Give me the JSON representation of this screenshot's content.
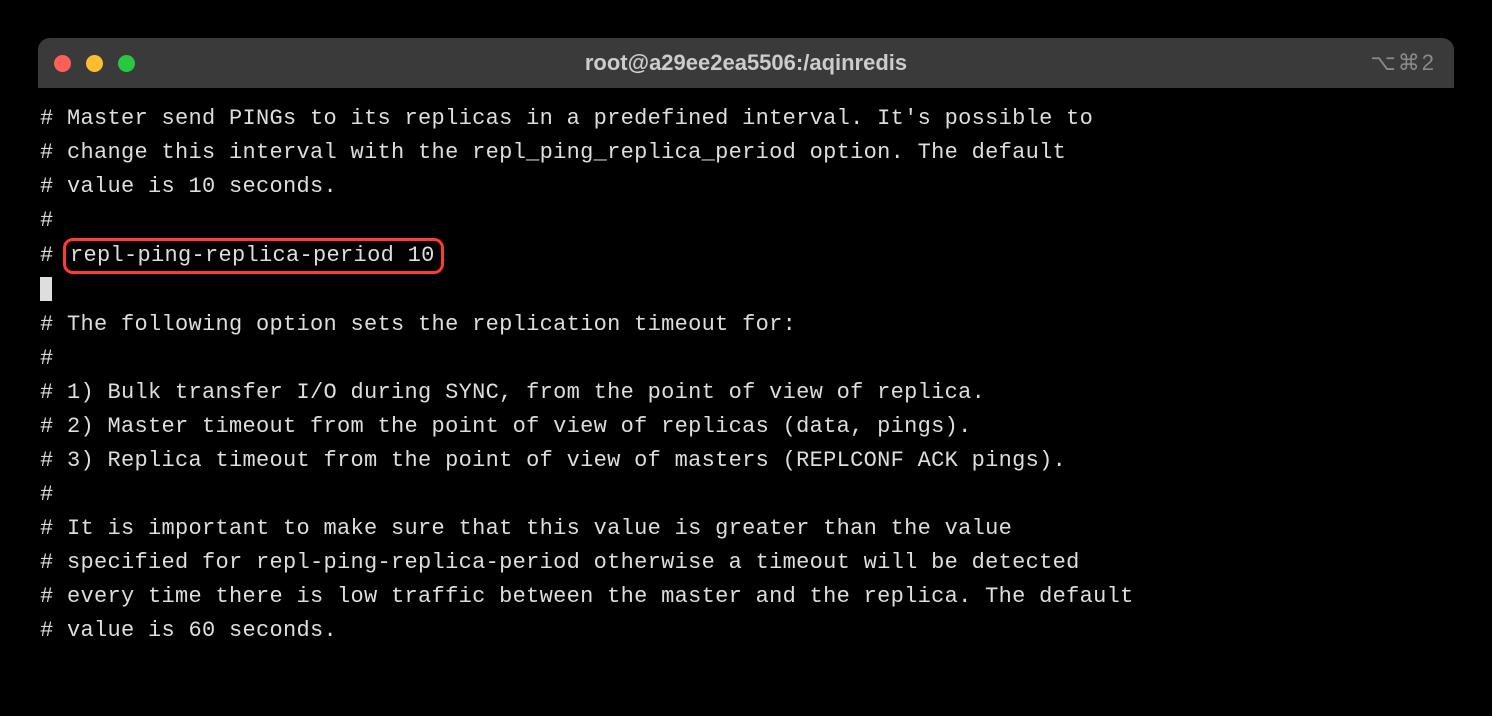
{
  "titlebar": {
    "title": "root@a29ee2ea5506:/aqinredis",
    "shortcut": "⌥⌘2"
  },
  "lines": {
    "l0": "# Master send PINGs to its replicas in a predefined interval. It's possible to",
    "l1": "# change this interval with the repl_ping_replica_period option. The default",
    "l2": "# value is 10 seconds.",
    "l3": "#",
    "l4_prefix": "# ",
    "l4_highlight": "repl-ping-replica-period 10",
    "l5": "# The following option sets the replication timeout for:",
    "l6": "#",
    "l7": "# 1) Bulk transfer I/O during SYNC, from the point of view of replica.",
    "l8": "# 2) Master timeout from the point of view of replicas (data, pings).",
    "l9": "# 3) Replica timeout from the point of view of masters (REPLCONF ACK pings).",
    "l10": "#",
    "l11": "# It is important to make sure that this value is greater than the value",
    "l12": "# specified for repl-ping-replica-period otherwise a timeout will be detected",
    "l13": "# every time there is low traffic between the master and the replica. The default",
    "l14": "# value is 60 seconds."
  }
}
